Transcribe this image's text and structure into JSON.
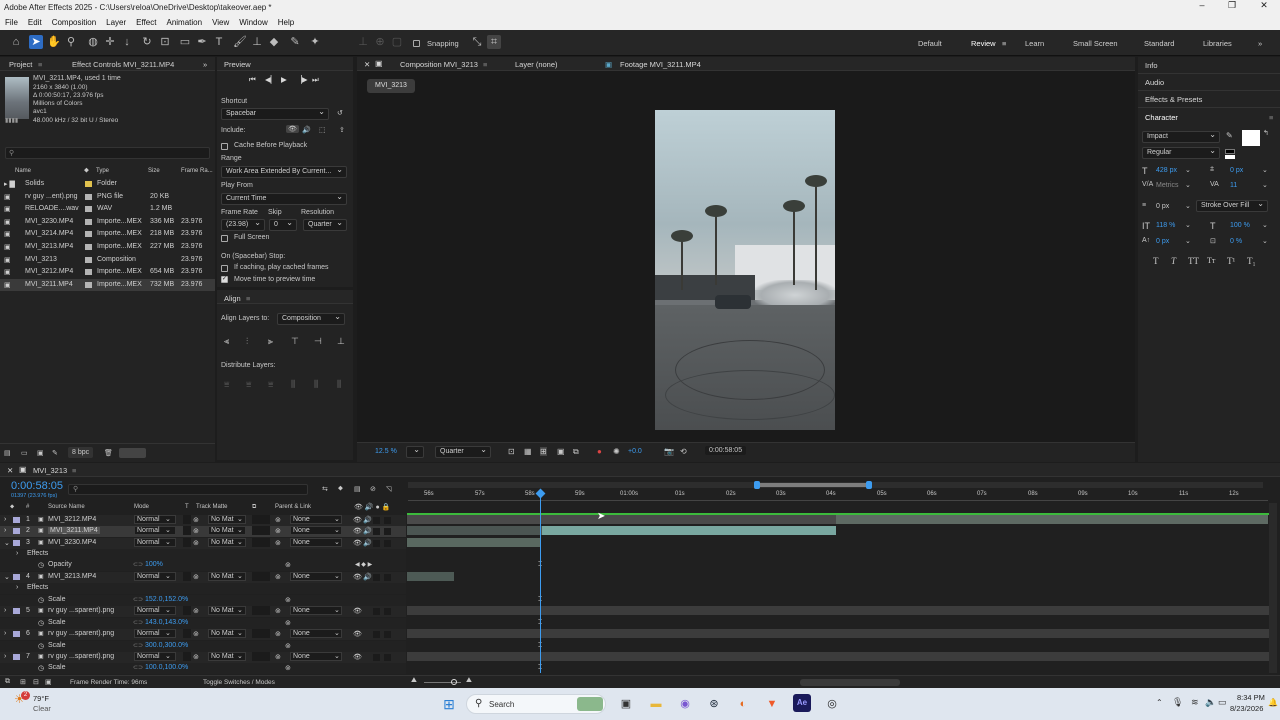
{
  "window": {
    "title": "Adobe After Effects 2025 - C:\\Users\\reloa\\OneDrive\\Desktop\\takeover.aep *"
  },
  "menu": [
    "File",
    "Edit",
    "Composition",
    "Layer",
    "Effect",
    "Animation",
    "View",
    "Window",
    "Help"
  ],
  "toolbar": {
    "snapping": "Snapping",
    "workspaces": [
      "Default",
      "Review",
      "Learn",
      "Small Screen",
      "Standard",
      "Libraries"
    ],
    "active_workspace": "Review"
  },
  "project": {
    "tab": "Project",
    "effect_tab": "Effect Controls MVI_3211.MP4",
    "info": {
      "name": "MVI_3211.MP4",
      "used": ", used 1 time",
      "dims": "2160 x 3840 (1.00)",
      "duration": "Δ 0:00:50:17, 23.976 fps",
      "colors": "Millions of Colors",
      "codec": "avc1",
      "audio": "48.000 kHz / 32 bit U / Stereo"
    },
    "search_placeholder": "",
    "columns": [
      "Name",
      "Type",
      "Size",
      "Frame Ra..."
    ],
    "items": [
      {
        "name": "Solids",
        "type": "Folder",
        "size": "",
        "fr": "",
        "color": "#e1c24e"
      },
      {
        "name": "rv guy ...ent).png",
        "type": "PNG file",
        "size": "20 KB",
        "fr": "",
        "color": "#b4b4b4"
      },
      {
        "name": "RELOADE....wav",
        "type": "WAV",
        "size": "1.2 MB",
        "fr": "",
        "color": "#b4b4b4"
      },
      {
        "name": "MVI_3230.MP4",
        "type": "Importe...MEX",
        "size": "336 MB",
        "fr": "23.976",
        "color": "#b4b4b4"
      },
      {
        "name": "MVI_3214.MP4",
        "type": "Importe...MEX",
        "size": "218 MB",
        "fr": "23.976",
        "color": "#b4b4b4"
      },
      {
        "name": "MVI_3213.MP4",
        "type": "Importe...MEX",
        "size": "227 MB",
        "fr": "23.976",
        "color": "#b4b4b4"
      },
      {
        "name": "MVI_3213",
        "type": "Composition",
        "size": "",
        "fr": "23.976",
        "color": "#b4b4b4"
      },
      {
        "name": "MVI_3212.MP4",
        "type": "Importe...MEX",
        "size": "654 MB",
        "fr": "23.976",
        "color": "#b4b4b4"
      },
      {
        "name": "MVI_3211.MP4",
        "type": "Importe...MEX",
        "size": "732 MB",
        "fr": "23.976",
        "color": "#b4b4b4"
      }
    ],
    "bpc": "8 bpc"
  },
  "preview": {
    "tab": "Preview",
    "shortcut_label": "Shortcut",
    "shortcut": "Spacebar",
    "include": "Include:",
    "cache": "Cache Before Playback",
    "range_label": "Range",
    "range": "Work Area Extended By Current...",
    "play_from_label": "Play From",
    "play_from": "Current Time",
    "frame_rate_label": "Frame Rate",
    "skip_label": "Skip",
    "resolution_label": "Resolution",
    "frame_rate": "(23.98)",
    "skip": "0",
    "resolution": "Quarter",
    "full_screen": "Full Screen",
    "stop_label": "On (Spacebar) Stop:",
    "if_caching": "If caching, play cached frames",
    "move_time": "Move time to preview time"
  },
  "align": {
    "tab": "Align",
    "align_to_label": "Align Layers to:",
    "align_to": "Composition",
    "distribute": "Distribute Layers:"
  },
  "viewer": {
    "tabs": [
      "Composition MVI_3213",
      "Layer (none)",
      "Footage MVI_3211.MP4"
    ],
    "comp_tab": "MVI_3213",
    "zoom": "12.5 %",
    "resolution": "Quarter",
    "exposure": "+0.0",
    "timecode": "0:00:58:05"
  },
  "right": {
    "info": "Info",
    "audio": "Audio",
    "effects": "Effects & Presets",
    "character": "Character",
    "font": "Impact",
    "style": "Regular",
    "size": "428 px",
    "leading": "0 px",
    "kerning": "Metrics",
    "tracking": "11",
    "stroke": "0 px",
    "stroke_mode": "Stroke Over Fill",
    "vscale": "118 %",
    "hscale": "100 %",
    "baseline": "0 px",
    "tsume": "0 %"
  },
  "timeline": {
    "tab": "MVI_3213",
    "timecode": "0:00:58:05",
    "frame_info": "01397 (23.976 fps)",
    "columns": {
      "source": "Source Name",
      "mode": "Mode",
      "t": "T",
      "matte": "Track Matte",
      "parent": "Parent & Link"
    },
    "ruler": [
      "56s",
      "57s",
      "58s",
      "59s",
      "01:00s",
      "01s",
      "02s",
      "03s",
      "04s",
      "05s",
      "06s",
      "07s",
      "08s",
      "09s",
      "10s",
      "11s",
      "12s"
    ],
    "layers": [
      {
        "kind": "layer",
        "num": "1",
        "name": "MVI_3212.MP4",
        "mode": "Normal",
        "matte": "No Mat",
        "parent": "None",
        "color": "#a8a8d8"
      },
      {
        "kind": "layer",
        "num": "2",
        "name": "MVI_3211.MP4",
        "mode": "Normal",
        "matte": "No Mat",
        "parent": "None",
        "color": "#a8a8d8"
      },
      {
        "kind": "layer",
        "num": "3",
        "name": "MVI_3230.MP4",
        "mode": "Normal",
        "matte": "No Mat",
        "parent": "None",
        "color": "#a8a8d8"
      },
      {
        "kind": "prop",
        "name": "Effects",
        "value": ""
      },
      {
        "kind": "prop",
        "name": "Opacity",
        "value": "100%"
      },
      {
        "kind": "layer",
        "num": "4",
        "name": "MVI_3213.MP4",
        "mode": "Normal",
        "matte": "No Mat",
        "parent": "None",
        "color": "#a8a8d8"
      },
      {
        "kind": "prop",
        "name": "Effects",
        "value": ""
      },
      {
        "kind": "prop",
        "name": "Scale",
        "value": "152.0,152.0%"
      },
      {
        "kind": "layer",
        "num": "5",
        "name": "rv guy ...sparent).png",
        "mode": "Normal",
        "matte": "No Mat",
        "parent": "None",
        "color": "#a8a8d8"
      },
      {
        "kind": "prop",
        "name": "Scale",
        "value": "143.0,143.0%"
      },
      {
        "kind": "layer",
        "num": "6",
        "name": "rv guy ...sparent).png",
        "mode": "Normal",
        "matte": "No Mat",
        "parent": "None",
        "color": "#a8a8d8"
      },
      {
        "kind": "prop",
        "name": "Scale",
        "value": "300.0,300.0%"
      },
      {
        "kind": "layer",
        "num": "7",
        "name": "rv guy ...sparent).png",
        "mode": "Normal",
        "matte": "No Mat",
        "parent": "None",
        "color": "#a8a8d8"
      },
      {
        "kind": "prop",
        "name": "Scale",
        "value": "100.0,100.0%"
      }
    ],
    "render_time": "Frame Render Time: 96ms",
    "toggle": "Toggle Switches / Modes"
  },
  "taskbar": {
    "temp": "79°F",
    "weather": "Clear",
    "search": "Search",
    "time": "8:34 PM",
    "date": "8/23/2026",
    "badge": "2"
  }
}
